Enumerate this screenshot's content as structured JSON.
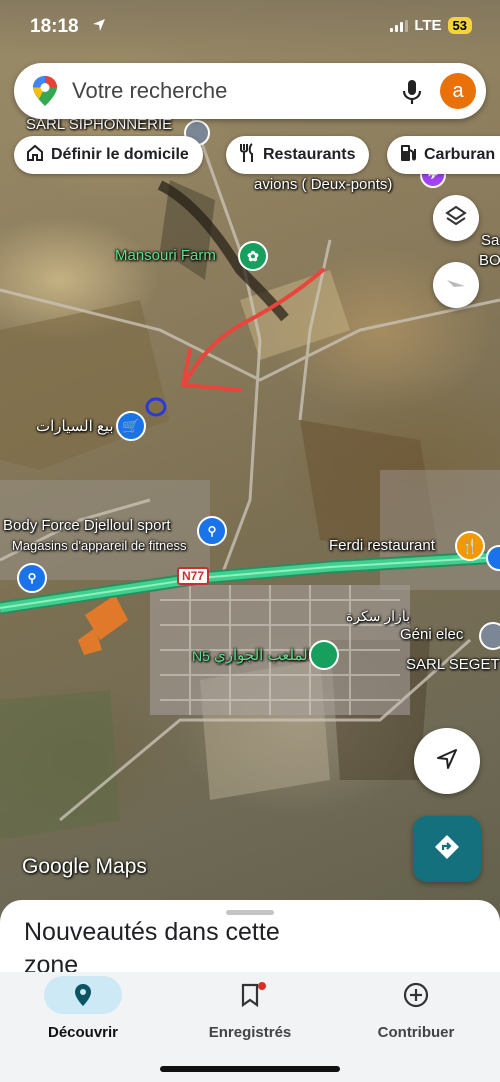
{
  "status_bar": {
    "time": "18:18",
    "network": "LTE",
    "battery": "53"
  },
  "search": {
    "placeholder": "Votre recherche",
    "avatar_letter": "a"
  },
  "chips": [
    {
      "label": "Définir le domicile",
      "icon": "home-icon"
    },
    {
      "label": "Restaurants",
      "icon": "restaurant-icon"
    },
    {
      "label": "Carburan",
      "icon": "gas-station-icon"
    }
  ],
  "map": {
    "labels": {
      "siphonnerie": "SARL SIPHONNERIE",
      "avions": "avions ( Deux-ponts)",
      "mansouri": "Mansouri Farm",
      "cars": "بيع السيارات",
      "body_force": "Body Force Djelloul sport",
      "fitness": "Magasins d'appareil de fitness",
      "ferdi": "Ferdi restaurant",
      "bazar": "بازار سكرة",
      "geni": "Géni elec",
      "seget": "SARL SEGET",
      "playground": "الملعب الجواري",
      "road_n77": "N77",
      "road_n5": "N5",
      "edge_sa": "Sa",
      "edge_bo": "BO"
    },
    "colors": {
      "highway": "#3fcf8e",
      "arrow": "#e8453c",
      "marker_circle": "#2a3ad6",
      "pin_blue": "#1a73e8",
      "pin_green": "#17a05d",
      "pin_orange": "#f29900"
    },
    "watermark": "Google Maps"
  },
  "sheet": {
    "title": "Nouveautés dans cette zone"
  },
  "nav": [
    {
      "label": "Découvrir",
      "icon": "location-pin-icon",
      "active": true
    },
    {
      "label": "Enregistrés",
      "icon": "bookmark-icon",
      "active": false
    },
    {
      "label": "Contribuer",
      "icon": "add-circle-icon",
      "active": false
    }
  ]
}
